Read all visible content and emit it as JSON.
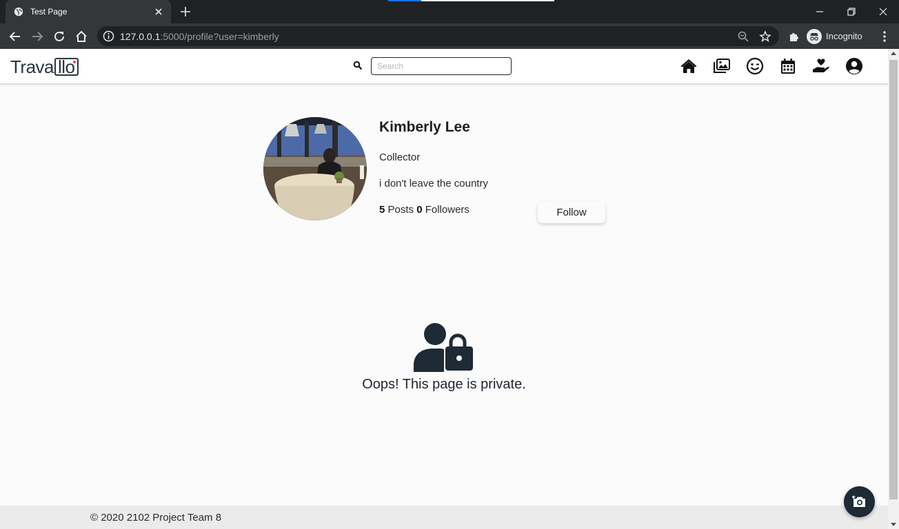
{
  "browser": {
    "tab_title": "Test Page",
    "url_host": "127.0.0.1",
    "url_rest": ":5000/profile?user=kimberly",
    "incognito_label": "Incognito"
  },
  "site": {
    "logo_text_a": "Trava",
    "logo_text_b": "llo",
    "search_placeholder": "Search",
    "nav_icons": [
      "home-icon",
      "gallery-icon",
      "smile-icon",
      "calendar-icon",
      "hand-heart-icon",
      "user-circle-icon"
    ]
  },
  "profile": {
    "name": "Kimberly Lee",
    "role": "Collector",
    "bio": "i don't leave the country",
    "posts_count": "5",
    "posts_label": "Posts",
    "followers_count": "0",
    "followers_label": "Followers",
    "follow_label": "Follow"
  },
  "private_notice": {
    "message": "Oops! This page is private."
  },
  "footer": {
    "text": "© 2020 2102 Project Team 8"
  },
  "colors": {
    "brand_dark": "#1e2a36",
    "chrome_dark": "#202124",
    "chrome_toolbar": "#35363a",
    "page_bg": "#fbfbfb"
  }
}
